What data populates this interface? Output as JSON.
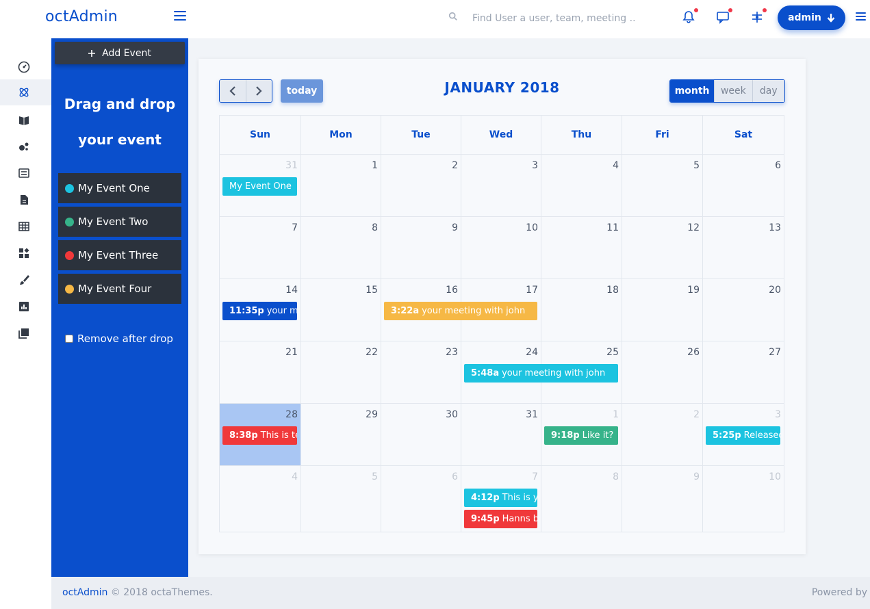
{
  "brand": "octAdmin",
  "search": {
    "placeholder": "Find User a user, team, meeting .."
  },
  "user": {
    "label": "admin"
  },
  "sidebar": {
    "add_event_label": "Add Event",
    "drag_title_line1": "Drag and drop",
    "drag_title_line2": "your event",
    "events": [
      {
        "label": "My Event One",
        "color": "#1cc3e0"
      },
      {
        "label": "My Event Two",
        "color": "#36b38a"
      },
      {
        "label": "My Event Three",
        "color": "#f0383a"
      },
      {
        "label": "My Event Four",
        "color": "#f6b845"
      }
    ],
    "remove_after_drop_label": "Remove after drop",
    "remove_after_drop_checked": false
  },
  "calendar": {
    "title": "JANUARY 2018",
    "today_label": "today",
    "views": [
      "month",
      "week",
      "day"
    ],
    "active_view": "month",
    "weekdays": [
      "Sun",
      "Mon",
      "Tue",
      "Wed",
      "Thu",
      "Fri",
      "Sat"
    ],
    "weeks": [
      [
        {
          "d": "31",
          "other": true
        },
        {
          "d": "1"
        },
        {
          "d": "2"
        },
        {
          "d": "3"
        },
        {
          "d": "4"
        },
        {
          "d": "5"
        },
        {
          "d": "6"
        }
      ],
      [
        {
          "d": "7"
        },
        {
          "d": "8"
        },
        {
          "d": "9"
        },
        {
          "d": "10"
        },
        {
          "d": "11"
        },
        {
          "d": "12"
        },
        {
          "d": "13"
        }
      ],
      [
        {
          "d": "14"
        },
        {
          "d": "15"
        },
        {
          "d": "16"
        },
        {
          "d": "17"
        },
        {
          "d": "18"
        },
        {
          "d": "19"
        },
        {
          "d": "20"
        }
      ],
      [
        {
          "d": "21"
        },
        {
          "d": "22"
        },
        {
          "d": "23"
        },
        {
          "d": "24"
        },
        {
          "d": "25"
        },
        {
          "d": "26"
        },
        {
          "d": "27"
        }
      ],
      [
        {
          "d": "28",
          "today": true
        },
        {
          "d": "29"
        },
        {
          "d": "30"
        },
        {
          "d": "31"
        },
        {
          "d": "1",
          "other": true
        },
        {
          "d": "2",
          "other": true
        },
        {
          "d": "3",
          "other": true
        }
      ],
      [
        {
          "d": "4",
          "other": true
        },
        {
          "d": "5",
          "other": true
        },
        {
          "d": "6",
          "other": true
        },
        {
          "d": "7",
          "other": true
        },
        {
          "d": "8",
          "other": true
        },
        {
          "d": "9",
          "other": true
        },
        {
          "d": "10",
          "other": true
        }
      ]
    ],
    "events": [
      {
        "week": 0,
        "day": 0,
        "span": 1,
        "slot": 0,
        "time": "",
        "title": "My Event One",
        "color": "#1cc3e0"
      },
      {
        "week": 2,
        "day": 0,
        "span": 1,
        "slot": 0,
        "time": "11:35p",
        "title": "your meeting with john",
        "color": "#0a4fcc"
      },
      {
        "week": 2,
        "day": 2,
        "span": 2,
        "slot": 0,
        "time": "3:22a",
        "title": "your meeting with john",
        "color": "#f6b845"
      },
      {
        "week": 3,
        "day": 3,
        "span": 2,
        "slot": 0,
        "time": "5:48a",
        "title": "your meeting with john",
        "color": "#1cc3e0"
      },
      {
        "week": 4,
        "day": 0,
        "span": 1,
        "slot": 0,
        "time": "8:38p",
        "title": "This is test event",
        "color": "#f0383a"
      },
      {
        "week": 4,
        "day": 4,
        "span": 1,
        "slot": 0,
        "time": "9:18p",
        "title": "Like it?",
        "color": "#36b38a"
      },
      {
        "week": 4,
        "day": 6,
        "span": 1,
        "slot": 0,
        "time": "5:25p",
        "title": "Released",
        "color": "#1cc3e0"
      },
      {
        "week": 5,
        "day": 3,
        "span": 1,
        "slot": 0,
        "time": "4:12p",
        "title": "This is your",
        "color": "#1cc3e0"
      },
      {
        "week": 5,
        "day": 3,
        "span": 1,
        "slot": 1,
        "time": "9:45p",
        "title": "Hanns birthday",
        "color": "#f0383a"
      }
    ]
  },
  "footer": {
    "brand": "octAdmin",
    "copyright": " © 2018 octaThemes.",
    "powered": "Powered by"
  }
}
